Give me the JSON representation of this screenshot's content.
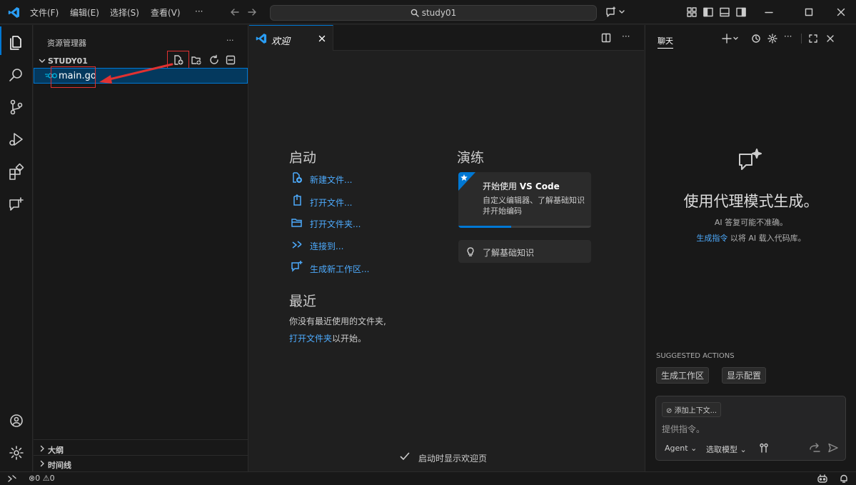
{
  "titlebar": {
    "menus": [
      "文件(F)",
      "编辑(E)",
      "选择(S)",
      "查看(V)",
      "···"
    ],
    "search": "study01"
  },
  "explorer": {
    "title": "资源管理器",
    "more": "···",
    "folder": "STUDY01",
    "file": "main.go",
    "outline": "大纲",
    "timeline": "时间线"
  },
  "editor": {
    "tab_label": "欢迎",
    "start": {
      "heading": "启动",
      "items": [
        "新建文件...",
        "打开文件...",
        "打开文件夹...",
        "连接到...",
        "生成新工作区..."
      ]
    },
    "recent": {
      "heading": "最近",
      "line1": "你没有最近使用的文件夹,",
      "link": "打开文件夹",
      "line2_suffix": "以开始。"
    },
    "walkthroughs": {
      "heading": "演练",
      "card_title_prefix": "开始使用 ",
      "card_title_bold": "VS Code",
      "card_desc": "自定义编辑器、了解基础知识并开始编码",
      "progress": 0.4,
      "basics": "了解基础知识"
    },
    "show_on_startup": "启动时显示欢迎页"
  },
  "chat": {
    "tab": "聊天",
    "heading": "使用代理模式生成。",
    "subtitle": "AI 答复可能不准确。",
    "hint_link": "生成指令",
    "hint_text": "以将 AI 载入代码库。",
    "suggested_title": "SUGGESTED ACTIONS",
    "suggested": [
      "生成工作区",
      "显示配置"
    ],
    "add_context": "添加上下文...",
    "placeholder": "提供指令。",
    "agent": "Agent",
    "model": "选取模型"
  },
  "statusbar": {
    "errors": "0",
    "warnings": "0"
  },
  "colors": {
    "accent": "#0078d4",
    "link": "#4daafc",
    "annotation": "#e03131"
  }
}
